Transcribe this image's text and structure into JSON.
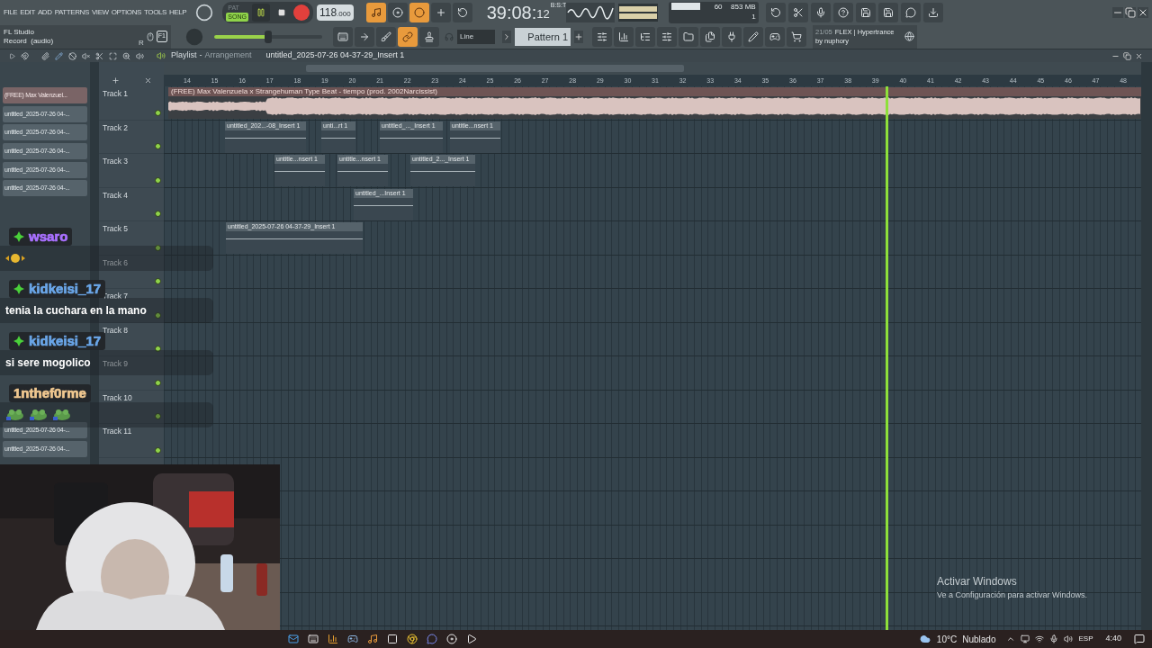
{
  "menu": [
    "FILE",
    "EDIT",
    "ADD",
    "PATTERNS",
    "VIEW",
    "OPTIONS",
    "TOOLS",
    "HELP"
  ],
  "hint_panel": {
    "title": "FL Studio",
    "text": "Record  (audio)",
    "shortcut": "R",
    "key": "F1"
  },
  "transport": {
    "modes": [
      {
        "label": "PAT",
        "selected": false
      },
      {
        "label": "SONG",
        "selected": true
      }
    ],
    "playing": true,
    "record_armed": true
  },
  "tempo": {
    "whole": "118",
    "fraction": ".000"
  },
  "time": {
    "main": "39:08:",
    "ticks": "12",
    "format": "B:S:T"
  },
  "cpu": {
    "value": "60",
    "memory": "853 MB",
    "polyphony": "1"
  },
  "master_volume": {
    "level": 0.5
  },
  "snap": "Line",
  "pattern": "Pattern 1",
  "news": {
    "date": "21/05",
    "title": "FLEX | Hypertrance",
    "author": "by nuphory"
  },
  "playlist": {
    "title": "Playlist",
    "separator": "-",
    "subtitle": "Arrangement",
    "current": "untitled_2025-07-26 04-37-29_Insert 1",
    "ruler": [
      "14",
      "15",
      "16",
      "17",
      "18",
      "19",
      "20",
      "21",
      "22",
      "23",
      "24",
      "25",
      "26",
      "27",
      "28",
      "29",
      "30",
      "31",
      "32",
      "33",
      "34",
      "35",
      "36",
      "37",
      "38",
      "39",
      "40",
      "41",
      "42",
      "43",
      "44",
      "45",
      "46",
      "47",
      "48"
    ],
    "picker": [
      {
        "label": "(FREE) Max Valenzuel...",
        "selected": true
      },
      {
        "label": "untitled_2025-07-26 04-...",
        "selected": false
      },
      {
        "label": "untitled_2025-07-26 04-...",
        "selected": false
      },
      {
        "label": "untitled_2025-07-26 04-...",
        "selected": false
      },
      {
        "label": "untitled_2025-07-26 04-...",
        "selected": false
      },
      {
        "label": "untitled_2025-07-26 04-...",
        "selected": false
      },
      {
        "label": "untitled_2025-07-26 04-...",
        "selected": false
      },
      {
        "label": "untitled_2025-07-26 04-...",
        "selected": false
      }
    ],
    "tracks": [
      {
        "name": "Track 1",
        "on": true,
        "clips": [
          {
            "kind": "audio",
            "label": "(FREE) Max Valenzuela x Strangehuman Type Beat - tiempo (prod. 2002Narcissist)"
          }
        ]
      },
      {
        "name": "Track 2",
        "on": true,
        "clips": [
          {
            "kind": "pattern",
            "label": "untitled_202...-08_Insert 1"
          },
          {
            "kind": "pattern",
            "label": "unti...rt 1"
          },
          {
            "kind": "pattern",
            "label": "untitled_..._Insert 1"
          },
          {
            "kind": "pattern",
            "label": "untitle...nsert 1"
          }
        ]
      },
      {
        "name": "Track 3",
        "on": true,
        "clips": [
          {
            "kind": "pattern",
            "label": "untitle...nsert 1"
          },
          {
            "kind": "pattern",
            "label": "untitle...nsert 1"
          },
          {
            "kind": "pattern",
            "label": "untitled_2..._Insert 1"
          }
        ]
      },
      {
        "name": "Track 4",
        "on": true,
        "clips": [
          {
            "kind": "pattern",
            "label": "untitled_...Insert 1"
          }
        ]
      },
      {
        "name": "Track 5",
        "on": true,
        "clips": [
          {
            "kind": "pattern",
            "label": "untitled_2025-07-26 04-37-29_Insert 1"
          }
        ]
      },
      {
        "name": "Track 6",
        "on": true
      },
      {
        "name": "Track 7",
        "on": true
      },
      {
        "name": "Track 8",
        "on": true
      },
      {
        "name": "Track 9",
        "on": true
      },
      {
        "name": "Track 10",
        "on": true
      },
      {
        "name": "Track 11",
        "on": true
      }
    ]
  },
  "chat": [
    {
      "user": "wsaro",
      "color": "#a970ff",
      "badge": true,
      "emotes": [
        {
          "kind": "emote"
        }
      ]
    },
    {
      "user": "kidkeisi_17",
      "color": "#6aa6e8",
      "badge": true,
      "text": "tenia la cuchara en la mano"
    },
    {
      "user": "kidkeisi_17",
      "color": "#6aa6e8",
      "badge": true,
      "text": "si sere mogolico"
    },
    {
      "user": "1nthef0rme",
      "color": "#f0c890",
      "badge": false,
      "emotes": [
        {
          "kind": "emote"
        },
        {
          "kind": "emote"
        },
        {
          "kind": "emote"
        }
      ]
    }
  ],
  "activation_notice": {
    "title": "Activar Windows",
    "text": "Ve a Configuración para activar Windows."
  },
  "taskbar": {
    "temperature": "10°C",
    "condition": "Nublado",
    "language": "ESP",
    "time": "4:40"
  }
}
